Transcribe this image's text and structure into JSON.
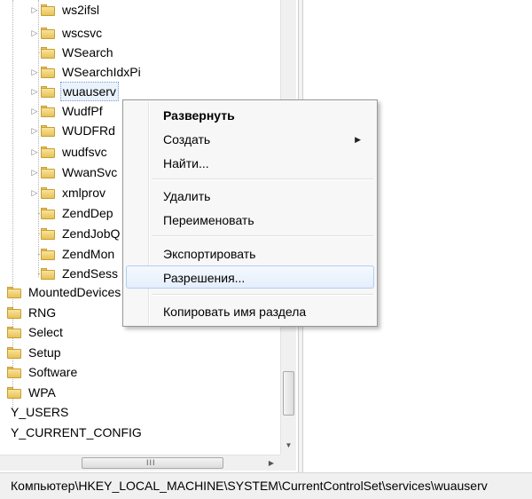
{
  "tree": {
    "subkeys": [
      {
        "label": "ws2ifsl",
        "expander": true
      },
      {
        "label": "wscsvc",
        "expander": true
      },
      {
        "label": "WSearch",
        "expander": false
      },
      {
        "label": "WSearchIdxPi",
        "expander": true
      },
      {
        "label": "wuauserv",
        "expander": true,
        "selected": true
      },
      {
        "label": "WudfPf",
        "expander": true
      },
      {
        "label": "WUDFRd",
        "expander": true
      },
      {
        "label": "wudfsvc",
        "expander": true
      },
      {
        "label": "WwanSvc",
        "expander": true
      },
      {
        "label": "xmlprov",
        "expander": true
      },
      {
        "label": "ZendDep",
        "expander": false
      },
      {
        "label": "ZendJobQ",
        "expander": false
      },
      {
        "label": "ZendMon",
        "expander": false
      },
      {
        "label": "ZendSess",
        "expander": false
      }
    ],
    "system_keys": [
      {
        "label": "MountedDevices"
      },
      {
        "label": "RNG"
      },
      {
        "label": "Select"
      },
      {
        "label": "Setup"
      },
      {
        "label": "Software"
      },
      {
        "label": "WPA"
      }
    ],
    "hives": [
      {
        "label": "Y_USERS"
      },
      {
        "label": "Y_CURRENT_CONFIG"
      }
    ],
    "expander_glyph": "▷",
    "scroll_down_glyph": "▼",
    "hscroll_grip": "III",
    "scroll_right_glyph": "▶"
  },
  "context_menu": {
    "items": [
      {
        "label": "Развернуть",
        "bold": true
      },
      {
        "label": "Создать",
        "submenu": true
      },
      {
        "label": "Найти..."
      },
      {
        "label": "Удалить"
      },
      {
        "label": "Переименовать"
      },
      {
        "label": "Экспортировать"
      },
      {
        "label": "Разрешения...",
        "hover": true
      },
      {
        "label": "Копировать имя раздела"
      }
    ],
    "submenu_glyph": "▶"
  },
  "status_bar": {
    "path": "Компьютер\\HKEY_LOCAL_MACHINE\\SYSTEM\\CurrentControlSet\\services\\wuauserv"
  }
}
